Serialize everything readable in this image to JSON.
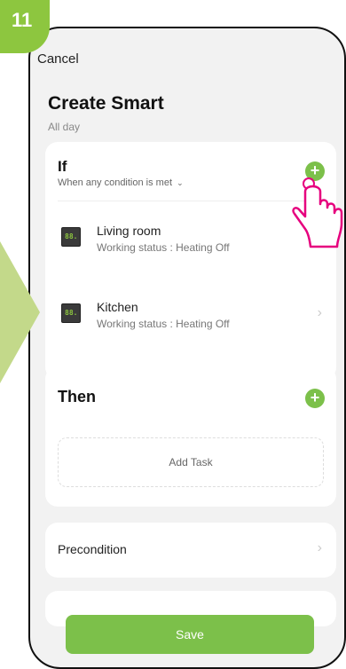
{
  "step": {
    "number": "11"
  },
  "colors": {
    "accent": "#7cc04a",
    "badge": "#8dc63f",
    "hand": "#e6007e"
  },
  "header": {
    "cancel_label": "Cancel",
    "title": "Create Smart",
    "subtitle": "All day"
  },
  "if_section": {
    "title": "If",
    "condition_mode": "When any condition is met",
    "add_icon": "plus-icon",
    "devices": [
      {
        "icon": "thermostat-icon",
        "display": "88.",
        "name": "Living room",
        "status": "Working status : Heating Off"
      },
      {
        "icon": "thermostat-icon",
        "display": "88.",
        "name": "Kitchen",
        "status": "Working status : Heating Off"
      }
    ]
  },
  "then_section": {
    "title": "Then",
    "add_icon": "plus-icon",
    "add_task_label": "Add Task"
  },
  "precondition": {
    "label": "Precondition"
  },
  "footer": {
    "save_label": "Save"
  }
}
